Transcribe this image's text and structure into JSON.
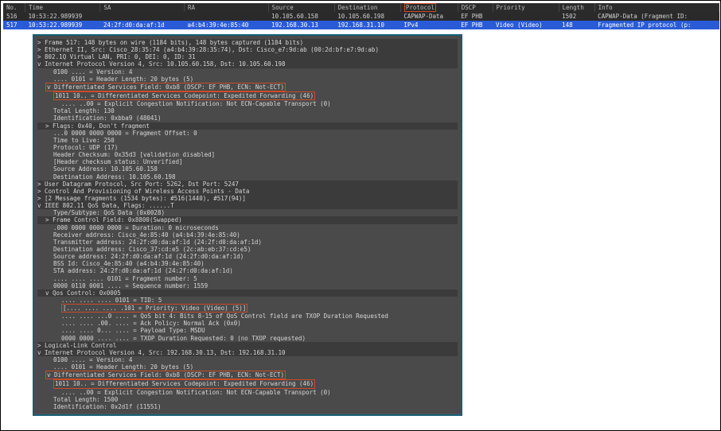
{
  "columns": [
    "No.",
    "Time",
    "SA",
    "RA",
    "Source",
    "Destination",
    "Protocol",
    "DSCP",
    "Priority",
    "Length",
    "Info"
  ],
  "rows": [
    {
      "no": "516",
      "time": "10:53:22.989939",
      "sa": "",
      "ra": "",
      "src": "10.105.60.158",
      "dst": "10.105.60.198",
      "proto": "CAPWAP-Data",
      "dscp": "EF PHB",
      "prio": "",
      "len": "1502",
      "info": "CAPWAP-Data (Fragment ID:"
    },
    {
      "no": "517",
      "time": "10:53:22.989939",
      "sa": "24:2f:d0:da:af:1d",
      "ra": "a4:b4:39:4e:85:40",
      "src": "192.168.30.13",
      "dst": "192.168.31.10",
      "proto": "IPv4",
      "dscp": "EF PHB",
      "prio": "Video (Video)",
      "len": "148",
      "info": "Fragmented IP protocol (p:"
    }
  ],
  "d": {
    "l01": "> Frame 517: 148 bytes on wire (1184 bits), 148 bytes captured (1184 bits)",
    "l02": "> Ethernet II, Src: Cisco_28:35:74 (a4:b4:39:28:35:74), Dst: Cisco_e7:9d:ab (00:2d:bf:e7:9d:ab)",
    "l03": "> 802.1Q Virtual LAN, PRI: 0, DEI: 0, ID: 31",
    "l04": "v Internet Protocol Version 4, Src: 10.105.60.158, Dst: 10.105.60.198",
    "l05": "0100 .... = Version: 4",
    "l06": ".... 0101 = Header Length: 20 bytes (5)",
    "l07": "v Differentiated Services Field: 0xb8 (DSCP: EF PHB, ECN: Not-ECT)",
    "l08": "1011 10.. = Differentiated Services Codepoint: Expedited Forwarding (46)",
    "l09": ".... ..00 = Explicit Congestion Notification: Not ECN-Capable Transport (0)",
    "l10": "Total Length: 130",
    "l11": "Identification: 0xbba9 (48041)",
    "l12": "> Flags: 0x40, Don't fragment",
    "l13": "...0 0000 0000 0000 = Fragment Offset: 0",
    "l14": "Time to Live: 250",
    "l15": "Protocol: UDP (17)",
    "l16": "Header Checksum: 0x35d3 [validation disabled]",
    "l17": "[Header checksum status: Unverified]",
    "l18": "Source Address: 10.105.60.158",
    "l19": "Destination Address: 10.105.60.198",
    "l20": "> User Datagram Protocol, Src Port: 5262, Dst Port: 5247",
    "l21": "> Control And Provisioning of Wireless Access Points - Data",
    "l22": "> [2 Message fragments (1534 bytes): #516(1440), #517(94)]",
    "l23": "v IEEE 802.11 QoS Data, Flags: ......T",
    "l24": "Type/Subtype: QoS Data (0x0028)",
    "l25": "> Frame Control Field: 0x8800(Swapped)",
    "l26": ".000 0000 0000 0000 = Duration: 0 microseconds",
    "l27": "Receiver address: Cisco_4e:85:40 (a4:b4:39:4e:85:40)",
    "l28": "Transmitter address: 24:2f:d0:da:af:1d (24:2f:d0:da:af:1d)",
    "l29": "Destination address: Cisco_37:cd:e5 (2c:ab:eb:37:cd:e5)",
    "l30": "Source address: 24:2f:d0:da:af:1d (24:2f:d0:da:af:1d)",
    "l31": "BSS Id: Cisco_4e:85:40 (a4:b4:39:4e:85:40)",
    "l32": "STA address: 24:2f:d0:da:af:1d (24:2f:d0:da:af:1d)",
    "l33": ".... .... .... 0101 = Fragment number: 5",
    "l34": "0000 0110 0001 .... = Sequence number: 1559",
    "l35": "v Qos Control: 0x0005",
    "l36": ".... .... .... 0101 = TID: 5",
    "l37": "[.... .... .... .101 = Priority: Video (Video) (5)]",
    "l38": ".... .... ...0 .... = QoS bit 4: Bits 8-15 of QoS Control field are TXOP Duration Requested",
    "l39": ".... .... .00. .... = Ack Policy: Normal Ack (0x0)",
    "l40": ".... .... 0... .... = Payload Type: MSDU",
    "l41": "0000 0000 .... .... = TXOP Duration Requested: 0 (no TXOP requested)",
    "l42": "> Logical-Link Control",
    "l43": "v Internet Protocol Version 4, Src: 192.168.30.13, Dst: 192.168.31.10",
    "l44": "0100 .... = Version: 4",
    "l45": ".... 0101 = Header Length: 20 bytes (5)",
    "l46": "v Differentiated Services Field: 0xb8 (DSCP: EF PHB, ECN: Not-ECT)",
    "l47": "1011 10.. = Differentiated Services Codepoint: Expedited Forwarding (46)",
    "l48": ".... ..00 = Explicit Congestion Notification: Not ECN-Capable Transport (0)",
    "l49": "Total Length: 1500",
    "l50": "Identification: 0x2d1f (11551)"
  }
}
